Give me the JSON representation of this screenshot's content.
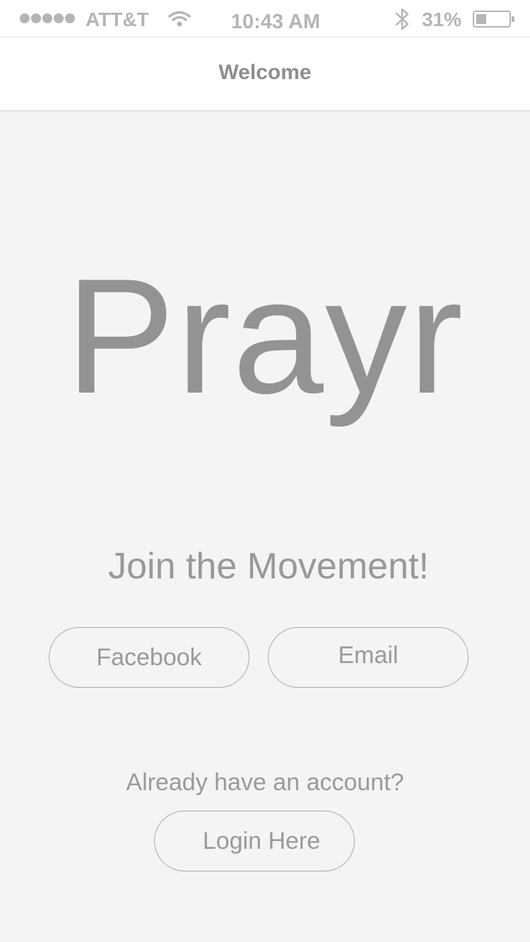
{
  "status_bar": {
    "carrier": "ATT&T",
    "time": "10:43 AM",
    "battery_percent": "31%",
    "battery_level": 0.31,
    "icons": [
      "signal-dots-icon",
      "wifi-icon",
      "bluetooth-icon",
      "battery-icon"
    ]
  },
  "nav": {
    "title": "Welcome"
  },
  "main": {
    "logo_text": "Prayr",
    "tagline": "Join the Movement!",
    "facebook_label": "Facebook",
    "email_label": "Email",
    "account_prompt": "Already have an account?",
    "login_label": "Login Here"
  },
  "colors": {
    "background": "#f3f4f4",
    "bar_background": "#ffffff",
    "text": "#939393",
    "button_border": "#a9a9a9"
  }
}
